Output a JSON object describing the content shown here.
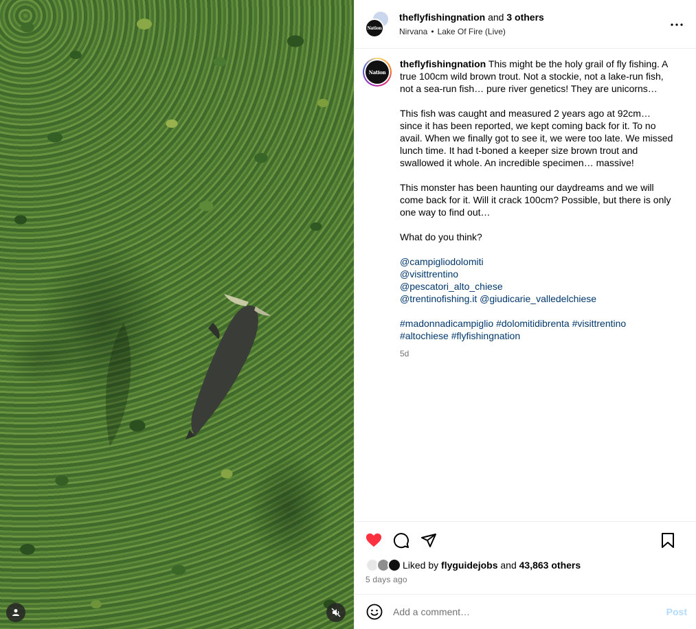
{
  "header": {
    "username": "theflyfishingnation",
    "and_text": "and",
    "others_text": "3 others",
    "audio_artist": "Nirvana",
    "separator": "•",
    "audio_track": "Lake Of Fire (Live)",
    "avatar_text": "Nation",
    "more_icon": "more-horizontal-icon"
  },
  "caption": {
    "username": "theflyfishingnation",
    "avatar_text": "Nation",
    "paragraphs": [
      "This might be the holy grail of fly fishing. A true 100cm wild brown trout. Not a stockie, not a lake-run fish, not a sea-run fish… pure river genetics! They are unicorns…",
      "This fish was caught and measured 2 years ago at 92cm… since it has been reported, we kept coming back for it. To no avail. When we finally got to see it, we were too late. We missed lunch time. It had t-boned a keeper size brown trout and swallowed it whole. An incredible specimen… massive!",
      "This monster has been haunting our daydreams and we will come back for it. Will it crack 100cm? Possible, but there is only one way to find out…",
      "What do you think?"
    ],
    "mentions": [
      "@campigliodolomiti",
      "@visittrentino",
      "@pescatori_alto_chiese",
      "@trentinofishing.it",
      "@giudicarie_valledelchiese"
    ],
    "hashtags": [
      "#madonnadicampiglio",
      "#dolomitidibrenta",
      "#visittrentino",
      "#altochiese",
      "#flyfishingnation"
    ],
    "time": "5d"
  },
  "actions": {
    "like_icon": "heart-filled-icon",
    "comment_icon": "comment-icon",
    "share_icon": "send-icon",
    "save_icon": "bookmark-icon",
    "like_color": "#ff3040"
  },
  "likes": {
    "prefix": "Liked by",
    "first_liker": "flyguidejobs",
    "and_text": "and",
    "others": "43,863 others"
  },
  "time_ago": "5 days ago",
  "comment": {
    "placeholder": "Add a comment…",
    "post_label": "Post",
    "emoji_icon": "emoji-icon"
  },
  "colors": {
    "link": "#00376b",
    "secondary_text": "#737373",
    "post_disabled": "#b3dbff"
  }
}
